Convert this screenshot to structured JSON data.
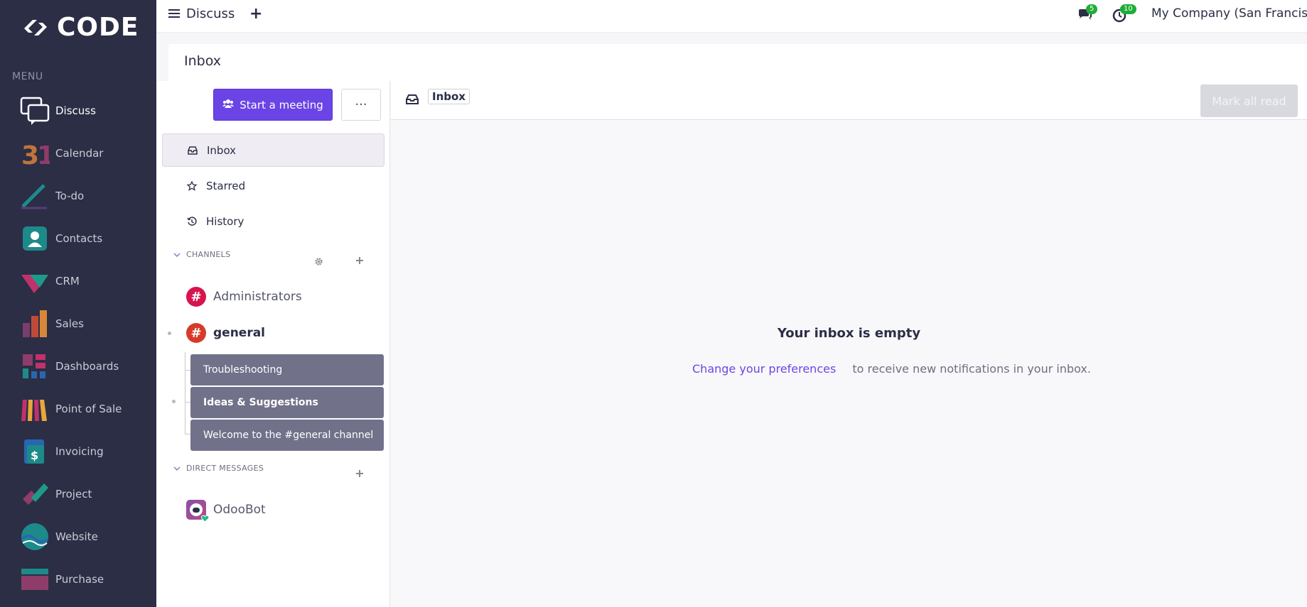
{
  "brand": {
    "logo_text": "CODE"
  },
  "menu": {
    "title": "MENU",
    "apps": [
      {
        "label": "Discuss",
        "icon": "discuss-icon",
        "active": true
      },
      {
        "label": "Calendar",
        "icon": "calendar-icon"
      },
      {
        "label": "To-do",
        "icon": "todo-icon"
      },
      {
        "label": "Contacts",
        "icon": "contacts-icon"
      },
      {
        "label": "CRM",
        "icon": "crm-icon"
      },
      {
        "label": "Sales",
        "icon": "sales-icon"
      },
      {
        "label": "Dashboards",
        "icon": "dashboards-icon"
      },
      {
        "label": "Point of Sale",
        "icon": "point-of-sale-icon"
      },
      {
        "label": "Invoicing",
        "icon": "invoicing-icon"
      },
      {
        "label": "Project",
        "icon": "project-icon"
      },
      {
        "label": "Website",
        "icon": "website-icon"
      },
      {
        "label": "Purchase",
        "icon": "purchase-icon"
      }
    ]
  },
  "topbar": {
    "title": "Discuss",
    "plus": "+",
    "messages_count": "5",
    "activities_count": "10",
    "company": "My Company (San Francisco"
  },
  "breadcrumb": {
    "title": "Inbox"
  },
  "discuss": {
    "start_meeting_label": "Start a meeting",
    "more_label": "···",
    "mailboxes": [
      {
        "label": "Inbox",
        "icon": "inbox-icon",
        "active": true
      },
      {
        "label": "Starred",
        "icon": "star-icon"
      },
      {
        "label": "History",
        "icon": "history-icon"
      }
    ],
    "channels_header": "CHANNELS",
    "channels": [
      {
        "name": "Administrators",
        "color": "#d6144e"
      },
      {
        "name": "general",
        "color": "#d63b2a"
      }
    ],
    "threads": [
      {
        "label": "Troubleshooting"
      },
      {
        "label": "Ideas & Suggestions"
      },
      {
        "label": "Welcome to the #general channel"
      }
    ],
    "dm_header": "DIRECT MESSAGES",
    "direct_messages": [
      {
        "name": "OdooBot"
      }
    ]
  },
  "main": {
    "header_title": "Inbox",
    "mark_all_read_label": "Mark all read",
    "empty_title": "Your inbox is empty",
    "empty_link": "Change your preferences",
    "empty_text": "to receive new notifications in your inbox."
  },
  "colors": {
    "accent": "#6b44e6",
    "sidebar_bg": "#2b2e45",
    "badge": "#1fad38",
    "thread_bg": "#72718a"
  }
}
